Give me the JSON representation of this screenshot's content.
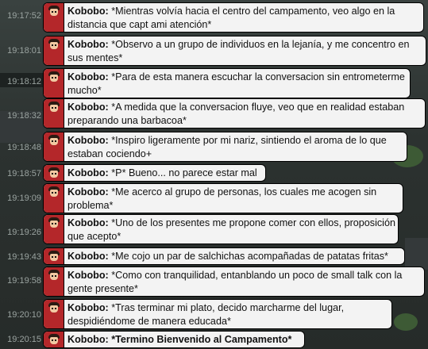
{
  "chat": {
    "username": "Kobobo:",
    "messages": [
      {
        "time": "19:17:52",
        "lines": [
          "*Mientras volvía hacia el centro del campamento, veo algo en la",
          "distancia que capt ami atención*"
        ]
      },
      {
        "time": "19:18:01",
        "lines": [
          "*Observo a un grupo de individuos en la lejanía, y me concentro en",
          "sus mentes*"
        ]
      },
      {
        "time": "19:18:12",
        "lines": [
          "*Para de esta manera escuchar la conversacion sin entrometerme",
          "mucho*"
        ]
      },
      {
        "time": "19:18:32",
        "lines": [
          "*A medida que la conversacion fluye, veo que en realidad estaban",
          "preparando una barbacoa*"
        ]
      },
      {
        "time": "19:18:48",
        "lines": [
          "*Inspiro ligeramente por mi nariz, sintiendo el aroma de lo que",
          "estaban cociendo+"
        ]
      },
      {
        "time": "19:18:57",
        "lines": [
          "*P* Bueno... no parece estar mal"
        ]
      },
      {
        "time": "19:19:09",
        "lines": [
          "*Me acerco al grupo de personas, los cuales me acogen sin",
          "problema*"
        ]
      },
      {
        "time": "19:19:26",
        "lines": [
          "*Uno de los presentes me propone comer con ellos, proposición",
          "que acepto*"
        ]
      },
      {
        "time": "19:19:43",
        "lines": [
          "*Me cojo un par de salchichas acompañadas de patatas fritas*"
        ]
      },
      {
        "time": "19:19:58",
        "lines": [
          "*Como con tranquilidad, entanblando un poco de small talk con la",
          "gente presente*"
        ]
      },
      {
        "time": "19:20:10",
        "lines": [
          "*Tras terminar mi plato, decido marcharme del lugar,",
          "despidiéndome de manera educada*"
        ]
      },
      {
        "time": "19:20:15",
        "lines": [
          "*Termino Bienvenido al Campamento*"
        ]
      }
    ]
  }
}
